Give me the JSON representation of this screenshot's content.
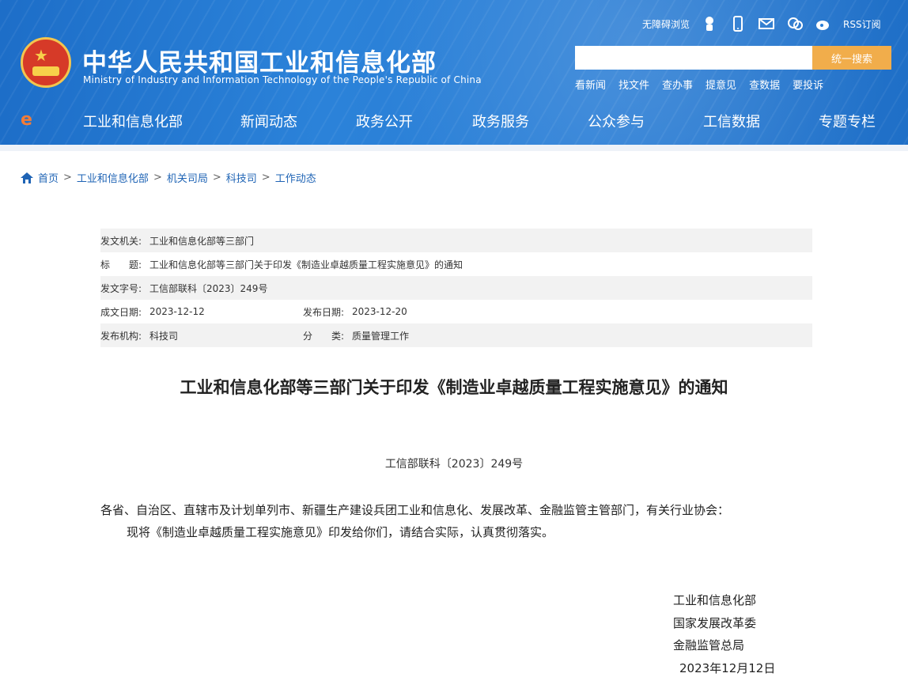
{
  "header": {
    "site_title": "中华人民共和国工业和信息化部",
    "site_subtitle": "Ministry of Industry and Information Technology of the People's Republic of China",
    "top_links": {
      "accessibility": "无障碍浏览",
      "rss": "RSS订阅"
    },
    "search": {
      "value": "",
      "placeholder": "",
      "button_label": "统一搜索"
    },
    "quick_links": [
      "看新闻",
      "找文件",
      "查办事",
      "提意见",
      "查数据",
      "要投诉"
    ],
    "nav": [
      "工业和信息化部",
      "新闻动态",
      "政务公开",
      "政务服务",
      "公众参与",
      "工信数据",
      "专题专栏"
    ]
  },
  "breadcrumb": {
    "items": [
      "首页",
      "工业和信息化部",
      "机关司局",
      "科技司",
      "工作动态"
    ],
    "separator": ">"
  },
  "meta": {
    "issuer_label": "发文机关:",
    "issuer_value": "工业和信息化部等三部门",
    "title_label": "标　　题:",
    "title_value": "工业和信息化部等三部门关于印发《制造业卓越质量工程实施意见》的通知",
    "doc_no_label": "发文字号:",
    "doc_no_value": "工信部联科〔2023〕249号",
    "date_written_label": "成文日期:",
    "date_written_value": "2023-12-12",
    "date_published_label": "发布日期:",
    "date_published_value": "2023-12-20",
    "publisher_label": "发布机构:",
    "publisher_value": "科技司",
    "category_label": "分　　类:",
    "category_value": "质量管理工作"
  },
  "document": {
    "title": "工业和信息化部等三部门关于印发《制造业卓越质量工程实施意见》的通知",
    "doc_no": "工信部联科〔2023〕249号",
    "addressee": "各省、自治区、直辖市及计划单列市、新疆生产建设兵团工业和信息化、发展改革、金融监管主管部门，有关行业协会：",
    "body": "现将《制造业卓越质量工程实施意见》印发给你们，请结合实际，认真贯彻落实。",
    "signatories": [
      "工业和信息化部",
      "国家发展改革委",
      "金融监管总局"
    ],
    "date": "2023年12月12日"
  },
  "colors": {
    "header_blue": "#2a7ed6",
    "search_button": "#f1ad4b",
    "link_blue": "#1f64b5",
    "meta_alt_row": "#f2f2f2"
  }
}
